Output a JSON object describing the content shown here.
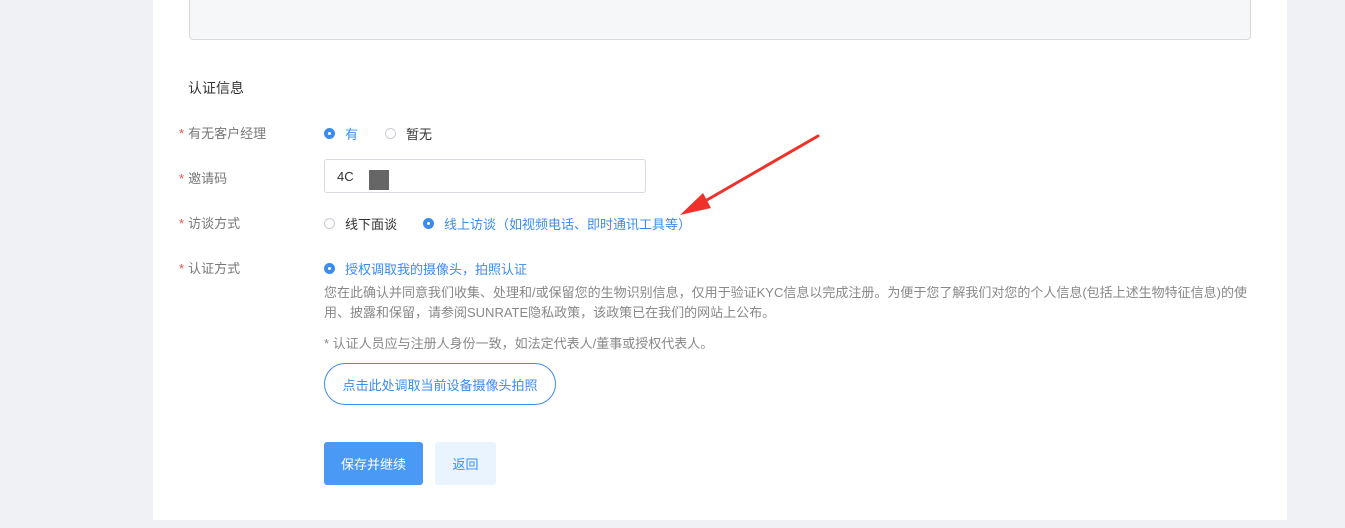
{
  "section_title": "认证信息",
  "required_mark": "*",
  "fields": {
    "manager": {
      "label": "有无客户经理",
      "options": [
        "有",
        "暂无"
      ],
      "selected": "有"
    },
    "invite_code": {
      "label": "邀请码",
      "value": "4C"
    },
    "interview": {
      "label": "访谈方式",
      "options": [
        "线下面谈",
        "线上访谈（如视频电话、即时通讯工具等）"
      ],
      "selected": "线上访谈（如视频电话、即时通讯工具等）"
    },
    "auth_method": {
      "label": "认证方式",
      "option": "授权调取我的摄像头，拍照认证",
      "description": "您在此确认并同意我们收集、处理和/或保留您的生物识别信息，仅用于验证KYC信息以完成注册。为便于您了解我们对您的个人信息(包括上述生物特征信息)的使用、披露和保留，请参阅SUNRATE隐私政策，该政策已在我们的网站上公布。",
      "note": "* 认证人员应与注册人身份一致，如法定代表人/董事或授权代表人。",
      "camera_button": "点击此处调取当前设备摄像头拍照"
    }
  },
  "actions": {
    "save": "保存并继续",
    "back": "返回"
  },
  "colors": {
    "accent": "#3c8cf0",
    "required": "#f04b4b",
    "annotation_arrow": "#f0312a"
  }
}
